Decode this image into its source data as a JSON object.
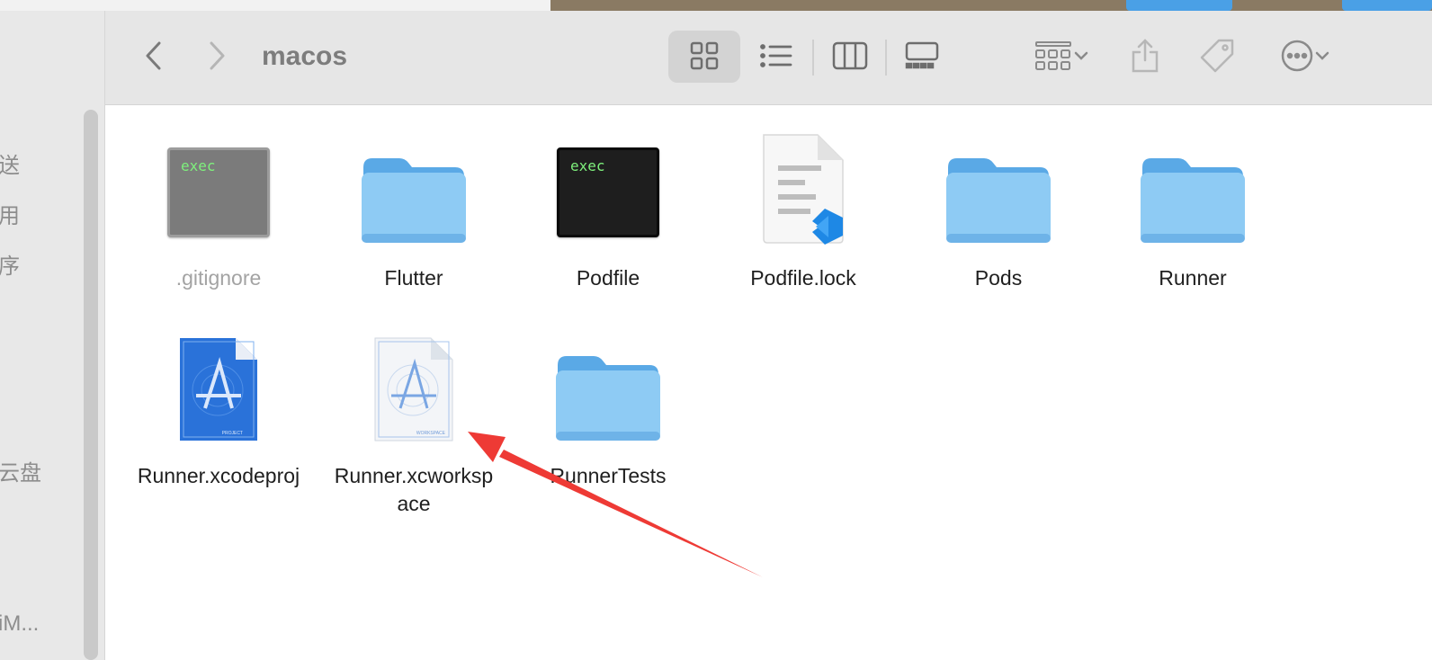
{
  "window": {
    "title": "macos",
    "toolbar": {
      "back_icon": "chevron-left-icon",
      "forward_icon": "chevron-right-icon",
      "views": [
        "icon-view-icon",
        "list-view-icon",
        "column-view-icon",
        "gallery-view-icon"
      ],
      "group_icon": "group-icon",
      "share_icon": "share-icon",
      "tag_icon": "tag-icon",
      "more_icon": "ellipsis-icon"
    }
  },
  "sidebar": {
    "items": [
      "送",
      "用",
      "序",
      "云盘",
      "iM..."
    ]
  },
  "files": [
    {
      "name": ".gitignore",
      "icon": "exec-gray-icon",
      "label": "exec"
    },
    {
      "name": "Flutter",
      "icon": "folder-icon"
    },
    {
      "name": "Podfile",
      "icon": "exec-black-icon",
      "label": "exec"
    },
    {
      "name": "Podfile.lock",
      "icon": "vscode-doc-icon"
    },
    {
      "name": "Pods",
      "icon": "folder-icon"
    },
    {
      "name": "Runner",
      "icon": "folder-icon"
    },
    {
      "name": "Runner.xcodeproj",
      "icon": "xcode-project-icon",
      "badge": "PROJECT"
    },
    {
      "name_line1": "Runner.xcworksp",
      "name_line2": "ace",
      "icon": "xcode-workspace-icon",
      "badge": "WORKSPACE"
    },
    {
      "name": "RunnerTests",
      "icon": "folder-icon"
    }
  ],
  "colors": {
    "folder": "#8ecbf4",
    "folder_tab": "#5aa9e6",
    "annotation_arrow": "#ee3a35"
  }
}
